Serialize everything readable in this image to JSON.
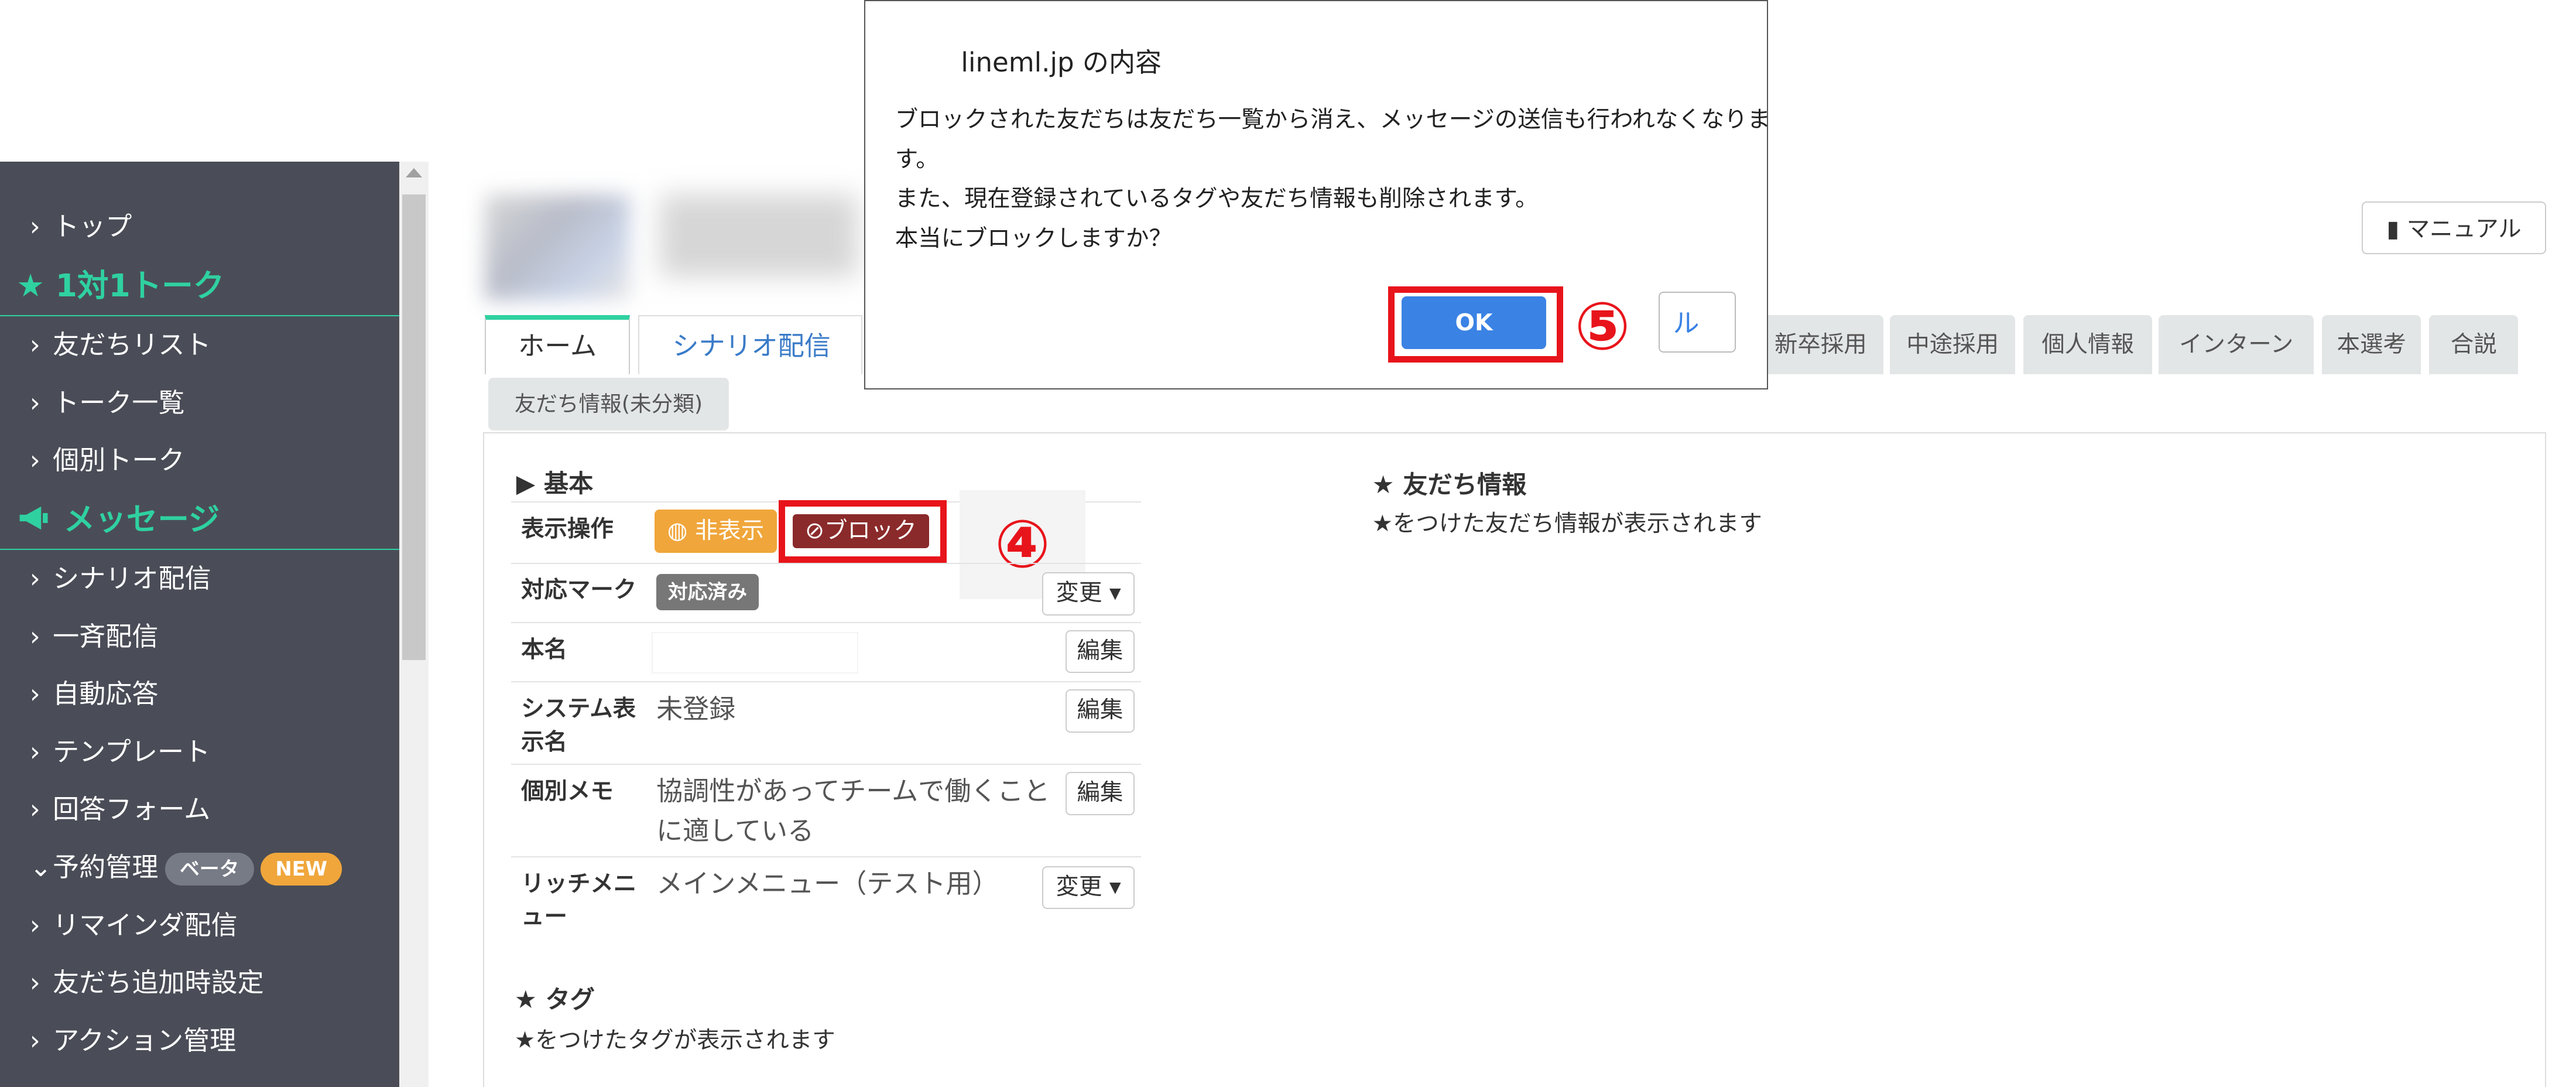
{
  "sidebar": {
    "items": [
      {
        "type": "item",
        "label": "トップ"
      },
      {
        "type": "head",
        "label": "1対1トーク",
        "icon": "★"
      },
      {
        "type": "item",
        "label": "友だちリスト"
      },
      {
        "type": "item",
        "label": "トーク一覧"
      },
      {
        "type": "item",
        "label": "個別トーク"
      },
      {
        "type": "head",
        "label": "メッセージ",
        "icon": "megaphone"
      },
      {
        "type": "item",
        "label": "シナリオ配信"
      },
      {
        "type": "item",
        "label": "一斉配信"
      },
      {
        "type": "item",
        "label": "自動応答"
      },
      {
        "type": "item",
        "label": "テンプレート"
      },
      {
        "type": "item",
        "label": "回答フォーム"
      },
      {
        "type": "item",
        "label": "予約管理",
        "expanded": true,
        "badges": [
          "ベータ",
          "NEW"
        ]
      },
      {
        "type": "item",
        "label": "リマインダ配信"
      },
      {
        "type": "item",
        "label": "友だち追加時設定"
      },
      {
        "type": "item",
        "label": "アクション管理"
      }
    ]
  },
  "header": {
    "manual_label": "マニュアル"
  },
  "tabs": {
    "home": "ホーム",
    "scenario": "シナリオ配信",
    "tag_tabs": [
      "新卒採用",
      "中途採用",
      "個人情報",
      "インターン",
      "本選考",
      "合説"
    ],
    "friend_info": "友だち情報(未分類)"
  },
  "basic": {
    "title": "▶ 基本",
    "rows": {
      "display_op": {
        "label": "表示操作",
        "hide_label": "非表示",
        "block_label": "ブロック"
      },
      "mark": {
        "label": "対応マーク",
        "badge": "対応済み",
        "btn": "変更"
      },
      "real_name": {
        "label": "本名",
        "value": "",
        "btn": "編集"
      },
      "system_name": {
        "label1": "システム表",
        "label2": "示名",
        "value": "未登録",
        "btn": "編集"
      },
      "memo": {
        "label": "個別メモ",
        "value1": "協調性があってチームで働くこと",
        "value2": "に適している",
        "btn": "編集"
      },
      "rich_menu": {
        "label1": "リッチメニ",
        "label2": "ュー",
        "value": "メインメニュー（テスト用）",
        "btn": "変更"
      }
    }
  },
  "friend_info": {
    "title": "★ 友だち情報",
    "note": "★をつけた友だち情報が表示されます"
  },
  "tags": {
    "title": "★ タグ",
    "note": "★をつけたタグが表示されます"
  },
  "annotations": {
    "step4": "④",
    "step5": "⑤"
  },
  "dialog": {
    "title": "lineml.jp の内容",
    "lines": [
      "ブロックされた友だちは友だち一覧から消え、メッセージの送信も行われなくなりま",
      "す。",
      "また、現在登録されているタグや友だち情報も削除されます。",
      "本当にブロックしますか？"
    ],
    "ok_label": "OK",
    "cancel_fragment": "ル"
  },
  "colors": {
    "accent": "#2fd1a1",
    "sidebar": "#4a4d57",
    "highlight": "#e8141b",
    "ok": "#3a82e4",
    "block": "#8b2a2a",
    "hide": "#f0a63b"
  }
}
